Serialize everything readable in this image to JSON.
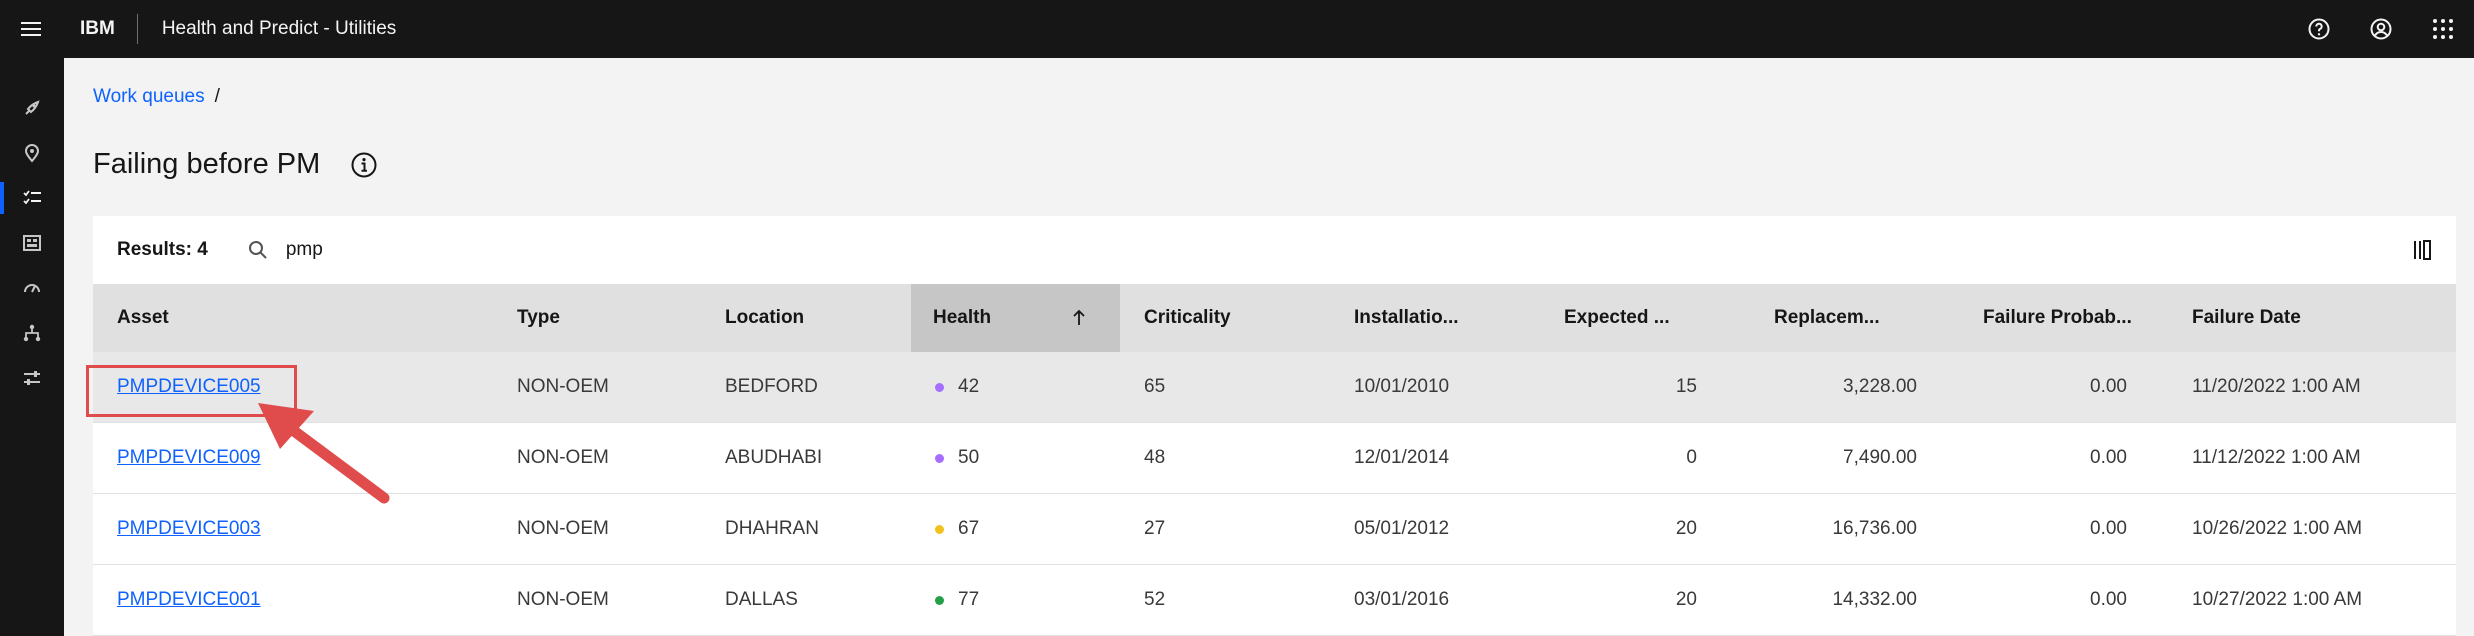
{
  "topbar": {
    "brand": "IBM",
    "product": "Health and Predict - Utilities"
  },
  "breadcrumb": {
    "link": "Work queues",
    "separator": "/"
  },
  "page": {
    "title": "Failing before PM"
  },
  "toolbar": {
    "results_label": "Results: 4",
    "search_value": "pmp"
  },
  "columns": [
    "Asset",
    "Type",
    "Location",
    "Health",
    "Criticality",
    "Installatio...",
    "Expected ...",
    "Replacem...",
    "Failure Probab...",
    "Failure Date"
  ],
  "sort": {
    "column": "Health",
    "direction": "ascending"
  },
  "rows": [
    {
      "asset": "PMPDEVICE005",
      "type": "NON-OEM",
      "location": "BEDFORD",
      "health": "42",
      "health_color": "#a56eff",
      "criticality": "65",
      "installation": "10/01/2010",
      "expected": "15",
      "replacement": "3,228.00",
      "failure_prob": "0.00",
      "failure_date": "11/20/2022 1:00 AM"
    },
    {
      "asset": "PMPDEVICE009",
      "type": "NON-OEM",
      "location": "ABUDHABI",
      "health": "50",
      "health_color": "#a56eff",
      "criticality": "48",
      "installation": "12/01/2014",
      "expected": "0",
      "replacement": "7,490.00",
      "failure_prob": "0.00",
      "failure_date": "11/12/2022 1:00 AM"
    },
    {
      "asset": "PMPDEVICE003",
      "type": "NON-OEM",
      "location": "DHAHRAN",
      "health": "67",
      "health_color": "#f1c21b",
      "criticality": "27",
      "installation": "05/01/2012",
      "expected": "20",
      "replacement": "16,736.00",
      "failure_prob": "0.00",
      "failure_date": "10/26/2022 1:00 AM"
    },
    {
      "asset": "PMPDEVICE001",
      "type": "NON-OEM",
      "location": "DALLAS",
      "health": "77",
      "health_color": "#24a148",
      "criticality": "52",
      "installation": "03/01/2016",
      "expected": "20",
      "replacement": "14,332.00",
      "failure_prob": "0.00",
      "failure_date": "10/27/2022 1:00 AM"
    }
  ],
  "colors": {
    "accent": "#0f62fe",
    "annotation": "#e04b4b"
  }
}
